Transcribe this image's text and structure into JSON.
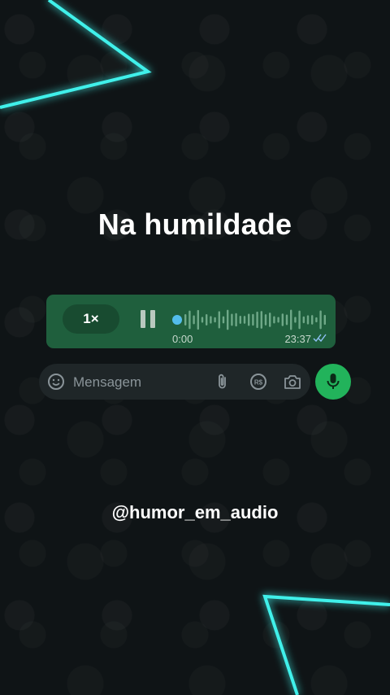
{
  "title": "Na humildade",
  "voice_message": {
    "speed_label": "1×",
    "elapsed": "0:00",
    "timestamp": "23:37",
    "status_icon": "double-check-icon",
    "progress": 0.0
  },
  "composer": {
    "placeholder": "Mensagem",
    "icons": [
      "sticker-icon",
      "attach-icon",
      "payment-icon",
      "camera-icon",
      "microphone-icon"
    ]
  },
  "handle": "@humor_em_audio",
  "colors": {
    "background": "#0f1416",
    "bubble": "#1f5f3d",
    "accent_green": "#22b35b",
    "neon": "#3ff0ea"
  }
}
